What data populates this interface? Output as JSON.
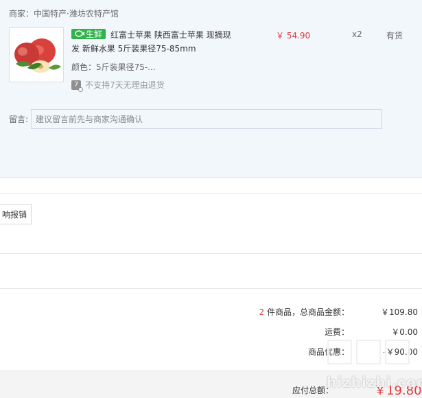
{
  "shop": {
    "label": "商家：",
    "name": "中国特产·潍坊农特产馆"
  },
  "item": {
    "tag_label": "生鲜",
    "title": "红富士苹果 陕西富士苹果 现摘现发 新鲜水果 5斤装果径75-85mm",
    "price": "￥ 54.90",
    "quantity": "x2",
    "stock": "有货",
    "attribute": "颜色：5斤装果径75-...",
    "service_note": "不支持7天无理由退货",
    "service_icon_text": "7"
  },
  "message": {
    "label": "留言:",
    "placeholder": "建议留言前先与商家沟通确认"
  },
  "invoice": {
    "button_label": "响报销"
  },
  "summary": {
    "count": "2",
    "count_suffix": " 件商品，总商品金额：",
    "total_goods": "￥109.80",
    "shipping_label": "运费：",
    "shipping_value": "￥0.00",
    "discount_label": "商品优惠：",
    "discount_value": "-￥90.00",
    "payable_label": "应付总额：",
    "payable_value": "￥19.80"
  },
  "watermark": {
    "glyphs": "值值值",
    "domain": "hizhizhi.com"
  },
  "colors": {
    "accent_red": "#e4393c",
    "fresh_green": "#31b24a",
    "panel_bg": "#f2f7fc"
  }
}
